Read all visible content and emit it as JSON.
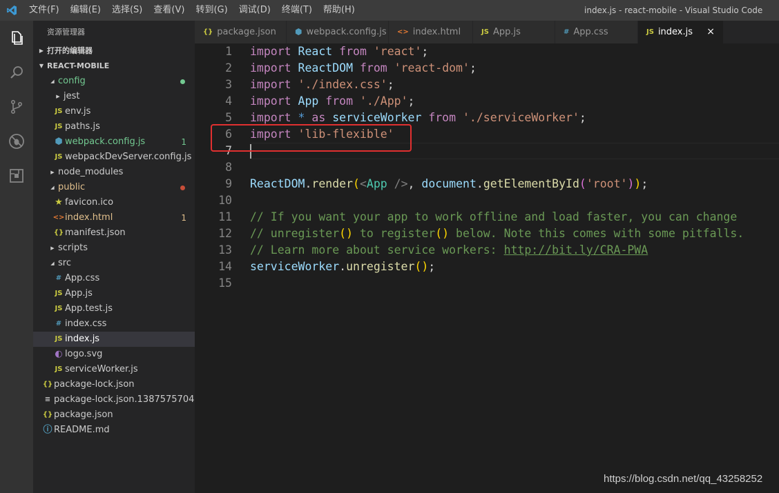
{
  "titlebar": {
    "menu": [
      "文件(F)",
      "编辑(E)",
      "选择(S)",
      "查看(V)",
      "转到(G)",
      "调试(D)",
      "终端(T)",
      "帮助(H)"
    ],
    "window_title": "index.js - react-mobile - Visual Studio Code"
  },
  "activitybar": [
    "explorer-icon",
    "search-icon",
    "source-control-icon",
    "debug-icon",
    "extensions-icon"
  ],
  "sidebar": {
    "title": "资源管理器",
    "open_editors": "打开的编辑器",
    "project": "REACT-MOBILE",
    "tree": [
      {
        "name": "config",
        "kind": "folder-open",
        "color": "#73c991",
        "dot": "#73c991"
      },
      {
        "name": "jest",
        "kind": "folder-closed"
      },
      {
        "name": "env.js",
        "kind": "js"
      },
      {
        "name": "paths.js",
        "kind": "js"
      },
      {
        "name": "webpack.config.js",
        "kind": "webpack",
        "color": "#73c991",
        "badge": "1"
      },
      {
        "name": "webpackDevServer.config.js",
        "kind": "js"
      },
      {
        "name": "node_modules",
        "kind": "folder-closed"
      },
      {
        "name": "public",
        "kind": "folder-open",
        "color": "#e2c08d",
        "dot": "#c74e39"
      },
      {
        "name": "favicon.ico",
        "kind": "star"
      },
      {
        "name": "index.html",
        "kind": "html",
        "color": "#e2c08d",
        "badge": "1"
      },
      {
        "name": "manifest.json",
        "kind": "json"
      },
      {
        "name": "scripts",
        "kind": "folder-closed"
      },
      {
        "name": "src",
        "kind": "folder-open"
      },
      {
        "name": "App.css",
        "kind": "css"
      },
      {
        "name": "App.js",
        "kind": "js"
      },
      {
        "name": "App.test.js",
        "kind": "js"
      },
      {
        "name": "index.css",
        "kind": "css"
      },
      {
        "name": "index.js",
        "kind": "js",
        "selected": true
      },
      {
        "name": "logo.svg",
        "kind": "svg"
      },
      {
        "name": "serviceWorker.js",
        "kind": "js"
      },
      {
        "name": "package-lock.json",
        "kind": "json"
      },
      {
        "name": "package-lock.json.1387575704",
        "kind": "text"
      },
      {
        "name": "package.json",
        "kind": "json"
      },
      {
        "name": "README.md",
        "kind": "info"
      }
    ]
  },
  "tabs": [
    {
      "label": "package.json",
      "icon": "{}"
    },
    {
      "label": "webpack.config.js",
      "icon": "webpack"
    },
    {
      "label": "index.html",
      "icon": "<>"
    },
    {
      "label": "App.js",
      "icon": "JS"
    },
    {
      "label": "App.css",
      "icon": "#"
    },
    {
      "label": "index.js",
      "icon": "JS",
      "active": true
    }
  ],
  "editor": {
    "line_numbers": [
      "1",
      "2",
      "3",
      "4",
      "5",
      "6",
      "7",
      "8",
      "9",
      "10",
      "11",
      "12",
      "13",
      "14",
      "15"
    ],
    "current_line": "7",
    "lines": [
      [
        [
          "k",
          "import"
        ],
        [
          "p",
          " "
        ],
        [
          "v",
          "React"
        ],
        [
          "p",
          " "
        ],
        [
          "k",
          "from"
        ],
        [
          "p",
          " "
        ],
        [
          "s",
          "'react'"
        ],
        [
          "p",
          ";"
        ]
      ],
      [
        [
          "k",
          "import"
        ],
        [
          "p",
          " "
        ],
        [
          "v",
          "ReactDOM"
        ],
        [
          "p",
          " "
        ],
        [
          "k",
          "from"
        ],
        [
          "p",
          " "
        ],
        [
          "s",
          "'react-dom'"
        ],
        [
          "p",
          ";"
        ]
      ],
      [
        [
          "k",
          "import"
        ],
        [
          "p",
          " "
        ],
        [
          "s",
          "'./index.css'"
        ],
        [
          "p",
          ";"
        ]
      ],
      [
        [
          "k",
          "import"
        ],
        [
          "p",
          " "
        ],
        [
          "v",
          "App"
        ],
        [
          "p",
          " "
        ],
        [
          "k",
          "from"
        ],
        [
          "p",
          " "
        ],
        [
          "s",
          "'./App'"
        ],
        [
          "p",
          ";"
        ]
      ],
      [
        [
          "k",
          "import"
        ],
        [
          "p",
          " "
        ],
        [
          "kw",
          "*"
        ],
        [
          "p",
          " "
        ],
        [
          "k",
          "as"
        ],
        [
          "p",
          " "
        ],
        [
          "v",
          "serviceWorker"
        ],
        [
          "p",
          " "
        ],
        [
          "k",
          "from"
        ],
        [
          "p",
          " "
        ],
        [
          "s",
          "'./serviceWorker'"
        ],
        [
          "p",
          ";"
        ]
      ],
      [
        [
          "k",
          "import"
        ],
        [
          "p",
          " "
        ],
        [
          "s",
          "'lib-flexible'"
        ]
      ],
      [],
      [],
      [
        [
          "v",
          "ReactDOM"
        ],
        [
          "p",
          "."
        ],
        [
          "f",
          "render"
        ],
        [
          "br",
          "("
        ],
        [
          "tag",
          "<"
        ],
        [
          "t",
          "App"
        ],
        [
          "p",
          " "
        ],
        [
          "tag",
          "/>"
        ],
        [
          "p",
          ", "
        ],
        [
          "v",
          "document"
        ],
        [
          "p",
          "."
        ],
        [
          "f",
          "getElementById"
        ],
        [
          "br2",
          "("
        ],
        [
          "s",
          "'root'"
        ],
        [
          "br2",
          ")"
        ],
        [
          "br",
          ")"
        ],
        [
          "p",
          ";"
        ]
      ],
      [],
      [
        [
          "c",
          "// If you want your app to work offline and load faster, you can change"
        ]
      ],
      [
        [
          "c",
          "// unregister"
        ],
        [
          "br",
          "()"
        ],
        [
          "c",
          " to register"
        ],
        [
          "br",
          "()"
        ],
        [
          "c",
          " below. Note this comes with some pitfalls."
        ]
      ],
      [
        [
          "c",
          "// Learn more about service workers: "
        ],
        [
          "cu",
          "http://bit.ly/CRA-PWA"
        ]
      ],
      [
        [
          "v",
          "serviceWorker"
        ],
        [
          "p",
          "."
        ],
        [
          "f",
          "unregister"
        ],
        [
          "br",
          "()"
        ],
        [
          "p",
          ";"
        ]
      ],
      []
    ]
  },
  "watermark": "https://blog.csdn.net/qq_43258252",
  "colors": {
    "accent": "#007acc",
    "highlight": "#e23030"
  }
}
